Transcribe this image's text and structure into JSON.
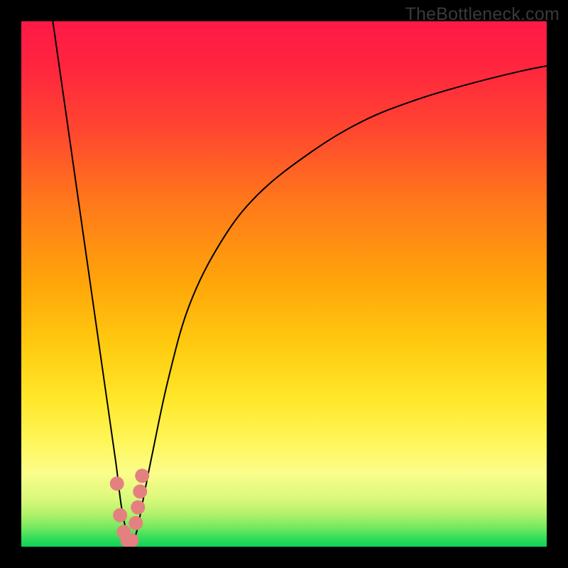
{
  "watermark": {
    "text": "TheBottleneck.com"
  },
  "colors": {
    "black": "#000000",
    "curve": "#000000",
    "marker": "#e48080",
    "gradient_stops": [
      {
        "offset": 0.0,
        "color": "#ff1946"
      },
      {
        "offset": 0.08,
        "color": "#ff2440"
      },
      {
        "offset": 0.2,
        "color": "#ff4430"
      },
      {
        "offset": 0.35,
        "color": "#ff7a1a"
      },
      {
        "offset": 0.5,
        "color": "#ffa60a"
      },
      {
        "offset": 0.62,
        "color": "#ffcc10"
      },
      {
        "offset": 0.72,
        "color": "#ffe72a"
      },
      {
        "offset": 0.8,
        "color": "#fff65a"
      },
      {
        "offset": 0.86,
        "color": "#fbfd8a"
      },
      {
        "offset": 0.91,
        "color": "#d9f97a"
      },
      {
        "offset": 0.94,
        "color": "#aef06a"
      },
      {
        "offset": 0.965,
        "color": "#6fe860"
      },
      {
        "offset": 0.985,
        "color": "#2fdc5a"
      },
      {
        "offset": 1.0,
        "color": "#0fd157"
      }
    ]
  },
  "chart_data": {
    "type": "line",
    "title": "",
    "xlabel": "",
    "ylabel": "",
    "xlim": [
      0,
      100
    ],
    "ylim": [
      0,
      100
    ],
    "grid": false,
    "series": [
      {
        "name": "bottleneck-curve",
        "x": [
          6,
          8,
          10,
          12,
          14,
          16,
          18,
          19,
          20,
          21,
          22,
          23,
          25,
          28,
          32,
          38,
          45,
          55,
          65,
          75,
          85,
          95,
          100
        ],
        "y": [
          100,
          86,
          72,
          58,
          44,
          30,
          16,
          8,
          3,
          1,
          3,
          8,
          18,
          32,
          46,
          58,
          67,
          75,
          81,
          85,
          88,
          90.5,
          91.5
        ]
      }
    ],
    "markers": {
      "name": "highlight-points",
      "x": [
        18.2,
        18.8,
        19.5,
        20.2,
        21.0,
        21.8,
        22.2,
        22.6,
        23.0
      ],
      "y": [
        12,
        6,
        2.8,
        1.2,
        1.2,
        4.5,
        7.5,
        10.5,
        13.5
      ]
    },
    "annotations": []
  }
}
